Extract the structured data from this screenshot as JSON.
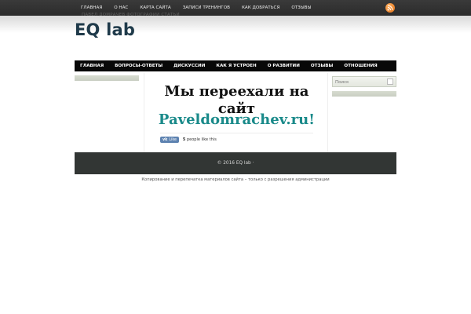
{
  "topnav": {
    "items": [
      "ГЛАВНАЯ",
      "О НАС",
      "КАРТА САЙТА",
      "ЗАПИСИ ТРЕНИНГОВ",
      "КАК ДОБРАТЬСЯ",
      "ОТЗЫВЫ"
    ],
    "overflow": "ПАВЕЛ ДОМРАЧЕВ ФОТОГРАФИИ СТАТЬИ"
  },
  "site": {
    "title": "EQ lab"
  },
  "mainnav": {
    "items": [
      "ГЛАВНАЯ",
      "ВОПРОСЫ-ОТВЕТЫ",
      "ДИСКУССИИ",
      "КАК Я УСТРОЕН",
      "О РАЗВИТИИ",
      "ОТЗЫВЫ",
      "ОТНОШЕНИЯ"
    ]
  },
  "content": {
    "moved_text": "Мы переехали на сайт",
    "link_text": "Paveldomrachev.ru!",
    "like_button": "Like",
    "like_logo": "vk",
    "like_count": "5",
    "like_suffix": "people like this"
  },
  "sidebar": {
    "search_placeholder": "Поиск"
  },
  "footer": {
    "text": "© 2016 EQ lab ·",
    "note": "Копирование и перепечатка материалов сайта – только с разрешения администрации"
  },
  "colors": {
    "accent_link": "#1a8a8a",
    "nav_bg": "#080808",
    "footer_bg": "#323634",
    "title": "#1f3a4a"
  },
  "icons": {
    "feed": "rss-icon",
    "search": "search-icon"
  }
}
